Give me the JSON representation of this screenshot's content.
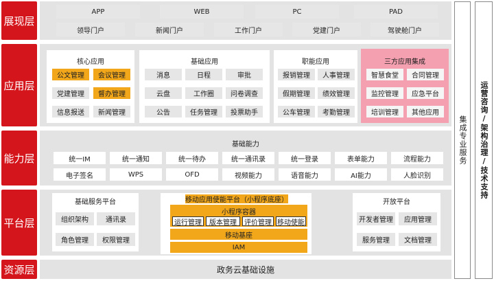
{
  "layers": {
    "presentation": "展现层",
    "application": "应用层",
    "capability": "能力层",
    "platform": "平台层",
    "resource": "资源层"
  },
  "presentation": {
    "row1": [
      "APP",
      "WEB",
      "PC",
      "PAD"
    ],
    "row2": [
      "领导门户",
      "新闻门户",
      "工作门户",
      "党建门户",
      "驾驶舱门户"
    ]
  },
  "application": {
    "core": {
      "title": "核心应用",
      "items": [
        "公文管理",
        "会议管理",
        "党建管理",
        "督办管理",
        "信息报送",
        "新闻管理"
      ],
      "highlighted": [
        true,
        true,
        false,
        true,
        false,
        false
      ]
    },
    "basic": {
      "title": "基础应用",
      "items": [
        "消息",
        "日程",
        "审批",
        "云盘",
        "工作圈",
        "问卷调查",
        "公告",
        "任务管理",
        "投票助手"
      ]
    },
    "functional": {
      "title": "职能应用",
      "items": [
        "报销管理",
        "人事管理",
        "假期管理",
        "绩效管理",
        "公车管理",
        "考勤管理"
      ]
    },
    "thirdparty": {
      "title": "三方应用集成",
      "items": [
        "智慧食堂",
        "合同管理",
        "监控管理",
        "应急平台",
        "培训管理",
        "其他应用"
      ]
    }
  },
  "capability": {
    "title": "基础能力",
    "row1": [
      "统一IM",
      "统一通知",
      "统一待办",
      "统一通讯录",
      "统一登录",
      "表单能力",
      "流程能力"
    ],
    "row2": [
      "电子签名",
      "WPS",
      "OFD",
      "视频能力",
      "语音能力",
      "AI能力",
      "人脸识别"
    ]
  },
  "platform": {
    "basic_service": {
      "title": "基础服务平台",
      "items": [
        "组织架构",
        "通讯录",
        "角色管理",
        "权限管理"
      ]
    },
    "mobile": {
      "title": "移动应用使能平台（小程序底座）",
      "container": "小程序容器",
      "container_items": [
        "运行管理",
        "版本管理",
        "评价管理",
        "移动使能"
      ],
      "base": "移动基座",
      "iam": "IAM"
    },
    "open": {
      "title": "开放平台",
      "items": [
        "开发者管理",
        "应用管理",
        "服务管理",
        "文档管理"
      ]
    }
  },
  "resource": {
    "label": "政务云基础设施"
  },
  "side": {
    "integration": "集成专业服务",
    "operations": "运营咨询/架构治理/技术支持"
  }
}
